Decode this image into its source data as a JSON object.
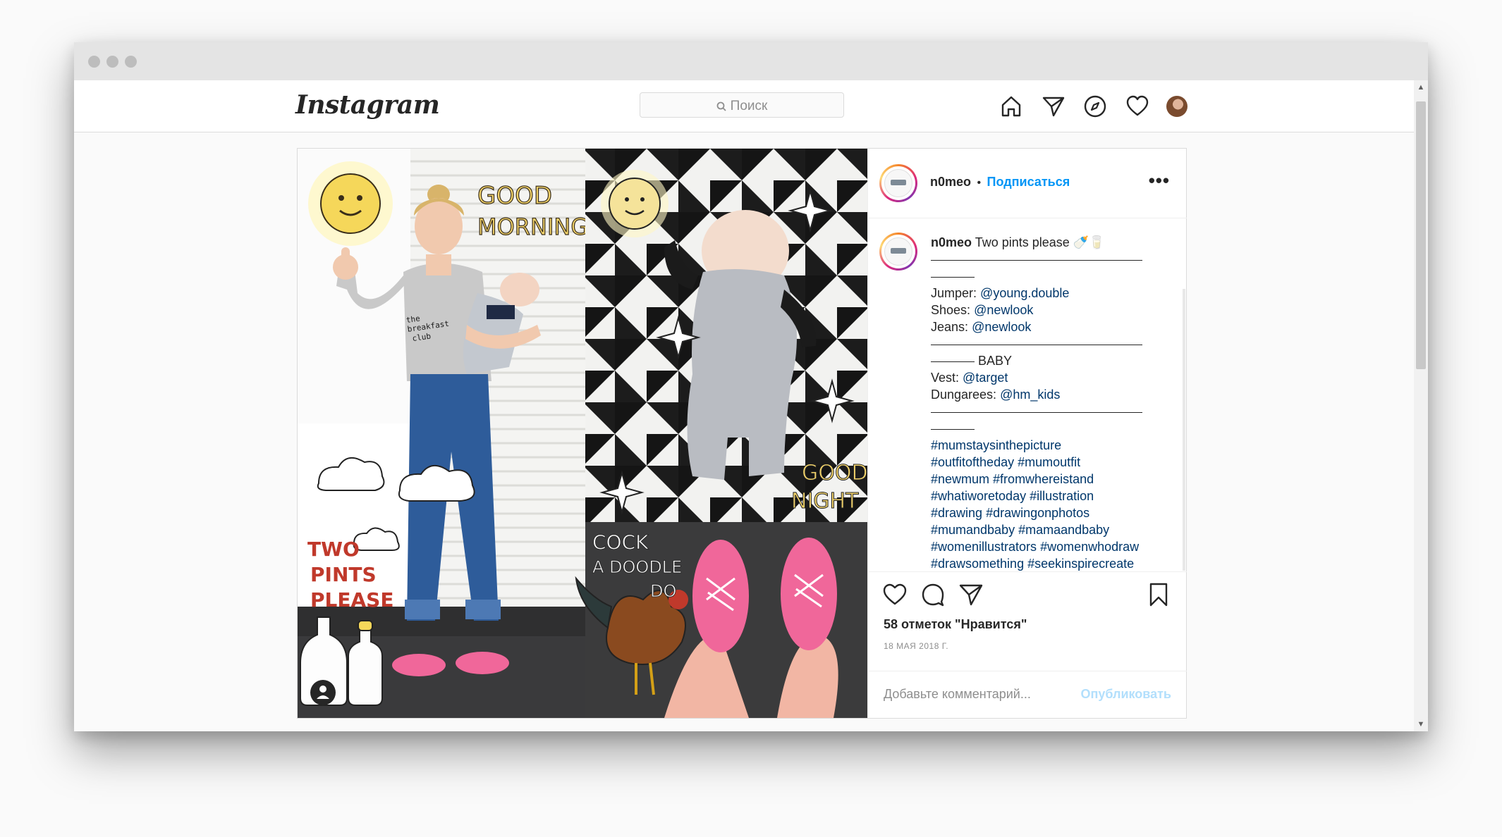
{
  "nav": {
    "logo": "Instagram",
    "search_placeholder": "Поиск"
  },
  "post": {
    "username": "n0meo",
    "separator": "•",
    "follow_label": "Подписаться",
    "more": "•••",
    "caption": {
      "username": "n0meo",
      "first_text": "Two pints please 🍼🥛",
      "lines": [
        {
          "type": "rule"
        },
        {
          "type": "shortrule"
        },
        {
          "type": "credit",
          "label": "Jumper:",
          "handle": "@young.double"
        },
        {
          "type": "credit",
          "label": "Shoes:",
          "handle": "@newlook"
        },
        {
          "type": "credit",
          "label": "Jeans:",
          "handle": "@newlook"
        },
        {
          "type": "rule"
        },
        {
          "type": "shortrule",
          "text": " BABY"
        },
        {
          "type": "credit",
          "label": "Vest:",
          "handle": "@target"
        },
        {
          "type": "credit",
          "label": "Dungarees:",
          "handle": "@hm_kids"
        },
        {
          "type": "rule"
        },
        {
          "type": "shortrule"
        },
        {
          "type": "tags",
          "tags": [
            "#mumstaysinthepicture"
          ]
        },
        {
          "type": "tags",
          "tags": [
            "#outfitoftheday",
            "#mumoutfit"
          ]
        },
        {
          "type": "tags",
          "tags": [
            "#newmum",
            "#fromwhereistand"
          ]
        },
        {
          "type": "tags",
          "tags": [
            "#whatiworetoday",
            "#illustration"
          ]
        },
        {
          "type": "tags",
          "tags": [
            "#drawing",
            "#drawingonphotos"
          ]
        },
        {
          "type": "tags",
          "tags": [
            "#mumandbaby",
            "#mamaandbaby"
          ]
        },
        {
          "type": "tags",
          "tags": [
            "#womenillustrators",
            "#womenwhodraw"
          ]
        },
        {
          "type": "tags",
          "tags": [
            "#drawsomething",
            "#seekinspirecreate"
          ]
        }
      ]
    },
    "likes": "58 отметок \"Нравится\"",
    "date": "18 МАЯ 2018 Г.",
    "comment_placeholder": "Добавьте комментарий...",
    "publish_label": "Опубликовать"
  },
  "photo": {
    "doodle_texts": {
      "good_morning_1": "GOOD",
      "good_morning_2": "MORNING",
      "good_night_1": "GOOD",
      "good_night_2": "NIGHT",
      "two_pints_1": "TWO",
      "two_pints_2": "PINTS",
      "two_pints_3": "PLEASE",
      "cock_1": "COCK",
      "cock_2": "A DOODLE",
      "cock_3": "DO",
      "sweater_1": "the",
      "sweater_2": "breakfast",
      "sweater_3": "club"
    }
  },
  "colors": {
    "accent": "#0095f6",
    "link": "#00376b",
    "shoe_pink": "#f0679a",
    "jeans": "#2e5c9a",
    "doodle_red": "#c0392b"
  }
}
